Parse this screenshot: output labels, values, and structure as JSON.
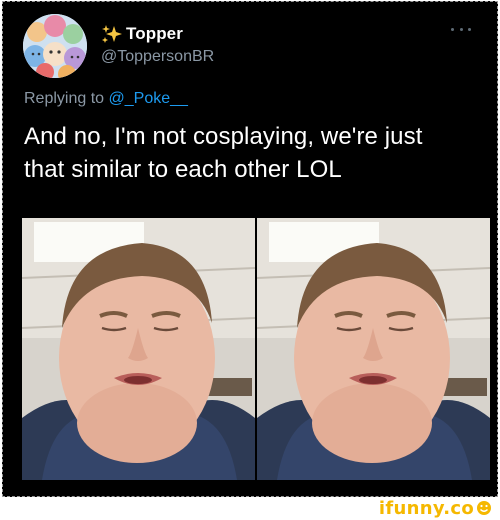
{
  "tweet": {
    "author": {
      "display_name": "Topper",
      "handle": "@ToppersonBR",
      "name_emoji": "sparkles-icon",
      "avatar": "anime-group-avatar"
    },
    "reply_to": {
      "prefix": "Replying to ",
      "mention": "@_Poke__"
    },
    "text_lines": [
      "And no, I'm not cosplaying, we're just",
      "that similar to each other LOL"
    ],
    "media": [
      {
        "alt_name": "selfie-photo-left"
      },
      {
        "alt_name": "selfie-photo-right"
      }
    ],
    "more_menu_icon": "more-options-icon"
  },
  "watermark": {
    "text": "ifunny.co",
    "icon": "smiley-icon"
  },
  "colors": {
    "background": "#000000",
    "text": "#ffffff",
    "secondary_text": "#8b98a5",
    "mention": "#1d9bf0",
    "watermark": "#f5b800"
  }
}
